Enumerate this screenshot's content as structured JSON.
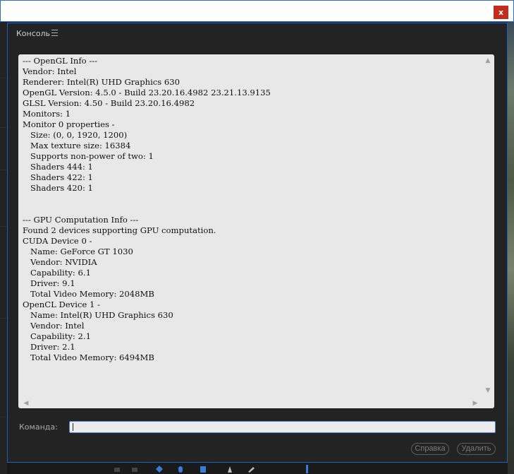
{
  "window": {
    "close_symbol": "x"
  },
  "panel": {
    "tab_label": "Консоль",
    "menu_icon": "hamburger-menu-icon"
  },
  "console": {
    "lines": [
      "--- OpenGL Info ---",
      "Vendor: Intel",
      "Renderer: Intel(R) UHD Graphics 630",
      "OpenGL Version: 4.5.0 - Build 23.20.16.4982 23.21.13.9135",
      "GLSL Version: 4.50 - Build 23.20.16.4982",
      "Monitors: 1",
      "Monitor 0 properties -",
      "   Size: (0, 0, 1920, 1200)",
      "   Max texture size: 16384",
      "   Supports non-power of two: 1",
      "   Shaders 444: 1",
      "   Shaders 422: 1",
      "   Shaders 420: 1",
      "",
      "",
      "--- GPU Computation Info ---",
      "Found 2 devices supporting GPU computation.",
      "CUDA Device 0 -",
      "   Name: GeForce GT 1030",
      "   Vendor: NVIDIA",
      "   Capability: 6.1",
      "   Driver: 9.1",
      "   Total Video Memory: 2048MB",
      "OpenCL Device 1 -",
      "   Name: Intel(R) UHD Graphics 630",
      "   Vendor: Intel",
      "   Capability: 2.1",
      "   Driver: 2.1",
      "   Total Video Memory: 6494MB"
    ]
  },
  "command": {
    "label": "Команда:",
    "value": ""
  },
  "buttons": {
    "help": "Справка",
    "delete": "Удалить"
  },
  "colors": {
    "accent": "#1565c0",
    "close": "#c42b1c",
    "console_bg": "#e8e8e8",
    "panel_bg": "#232323"
  }
}
